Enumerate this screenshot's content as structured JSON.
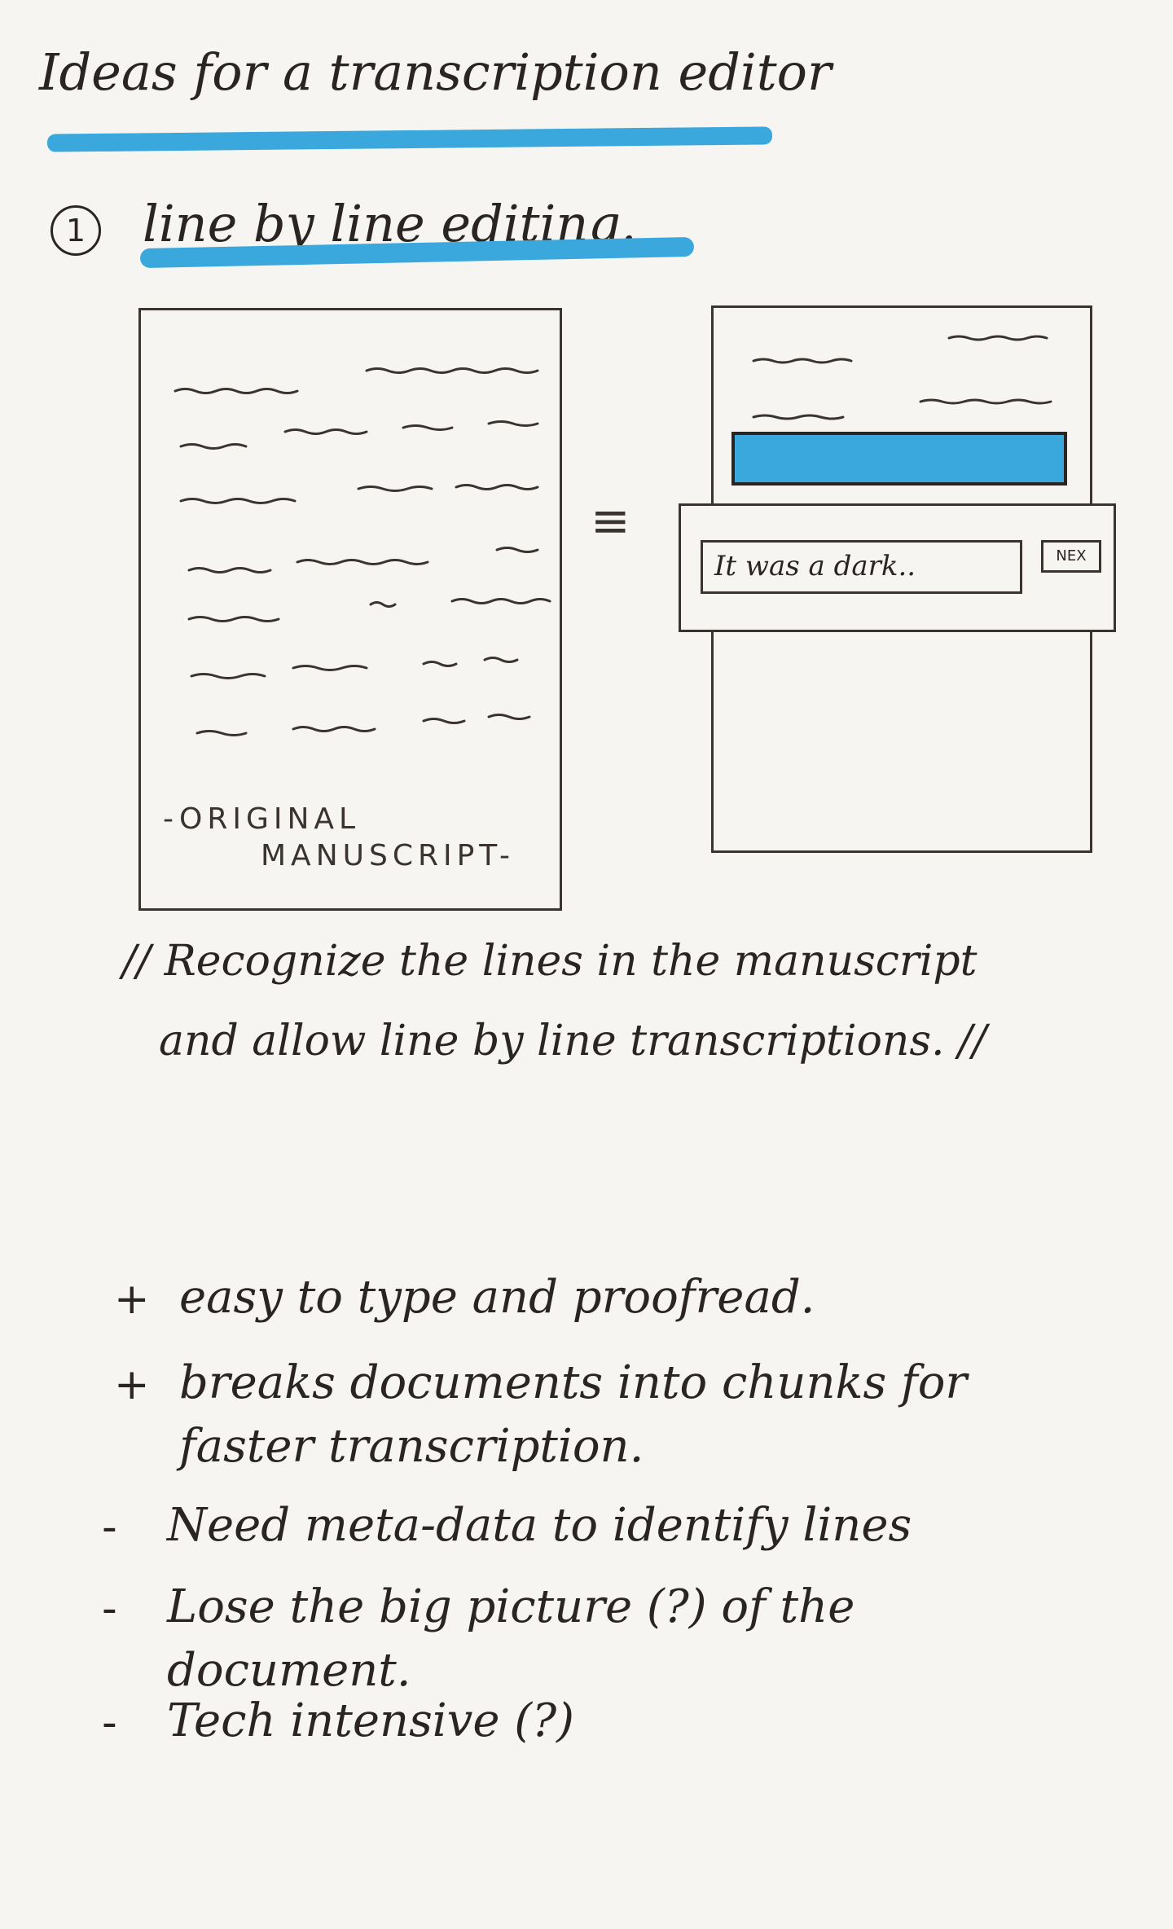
{
  "title": "Ideas for a transcription editor",
  "section": {
    "number": "1",
    "title": "line by line editing."
  },
  "manuscript_label": [
    "-ORIGINAL",
    "MANUSCRIPT-"
  ],
  "equivalence_symbol": "≡",
  "editor_mock": {
    "input_text": "It was a dark..",
    "next_button": "NEX"
  },
  "note": {
    "prefix": "//",
    "lines": [
      "Recognize the lines in the manuscript",
      "and allow line by line transcriptions."
    ],
    "suffix": "//"
  },
  "pros_cons": [
    {
      "sign": "+",
      "lines": [
        "easy to type and proofread."
      ]
    },
    {
      "sign": "+",
      "lines": [
        "breaks documents into chunks for",
        "faster transcription."
      ]
    },
    {
      "sign": "-",
      "lines": [
        "Need meta-data to identify lines"
      ]
    },
    {
      "sign": "-",
      "lines": [
        "Lose the big picture (?) of the",
        "document."
      ]
    },
    {
      "sign": "-",
      "lines": [
        "Tech intensive (?)"
      ]
    }
  ],
  "colors": {
    "highlight": "#3aa7dd",
    "ink": "#2a2522",
    "paper": "#f6f5f2"
  }
}
